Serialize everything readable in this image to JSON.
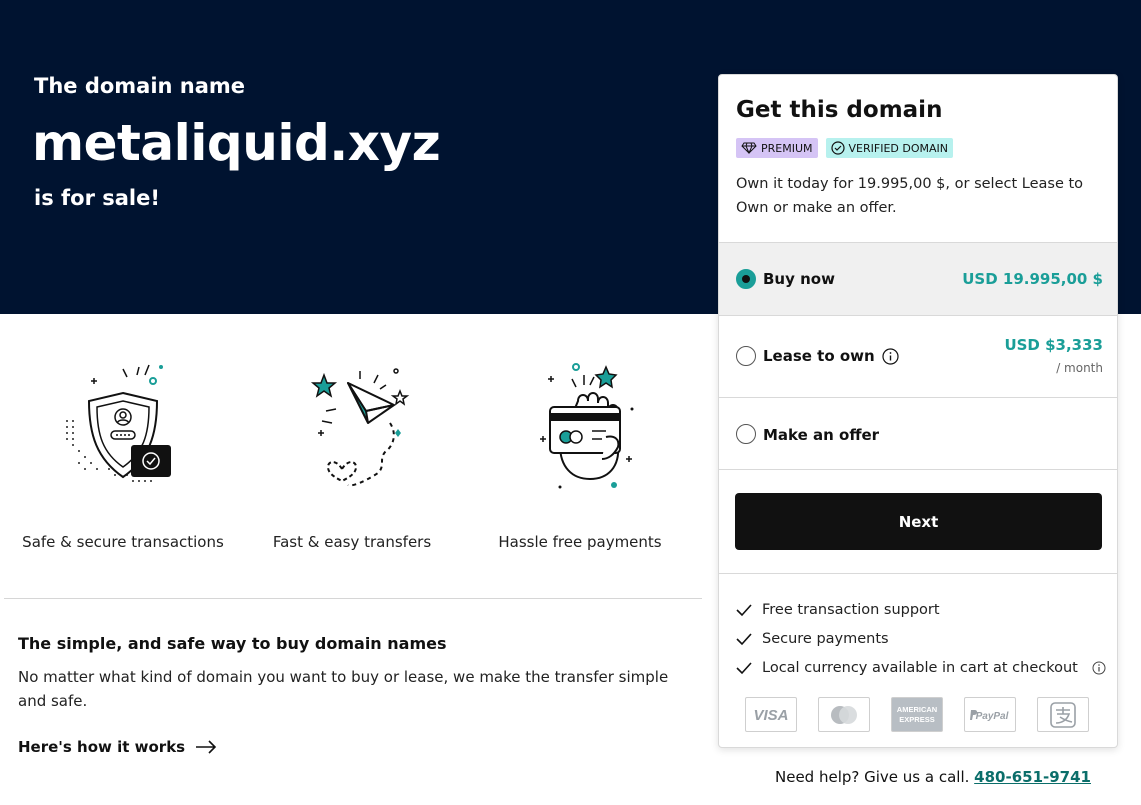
{
  "hero": {
    "kicker": "The domain name",
    "domain": "metaliquid.xyz",
    "sale_text": "is for sale!"
  },
  "features": [
    {
      "label": "Safe & secure transactions",
      "icon": "shield-user-icon"
    },
    {
      "label": "Fast & easy transfers",
      "icon": "paper-plane-icon"
    },
    {
      "label": "Hassle free payments",
      "icon": "card-payment-icon"
    }
  ],
  "info": {
    "title": "The simple, and safe way to buy domain names",
    "body": "No matter what kind of domain you want to buy or lease, we make the transfer simple and safe.",
    "link": "Here's how it works"
  },
  "card": {
    "title": "Get this domain",
    "badge_premium": "PREMIUM",
    "badge_verified": "VERIFIED DOMAIN",
    "description": "Own it today for 19.995,00 $, or select Lease to Own or make an offer.",
    "options": [
      {
        "label": "Buy now",
        "price": "USD 19.995,00 $",
        "selected": true
      },
      {
        "label": "Lease to own",
        "price": "USD $3,333",
        "sub": "/ month",
        "selected": false
      },
      {
        "label": "Make an offer",
        "selected": false
      }
    ],
    "next_label": "Next",
    "perks": [
      "Free transaction support",
      "Secure payments",
      "Local currency available in cart at checkout"
    ],
    "payment_methods": [
      "VISA",
      "mastercard",
      "AMERICAN EXPRESS",
      "PayPal",
      "alipay"
    ],
    "accent_color": "#1a9e98"
  },
  "help": {
    "text": "Need help? Give us a call.",
    "phone": "480-651-9741"
  }
}
